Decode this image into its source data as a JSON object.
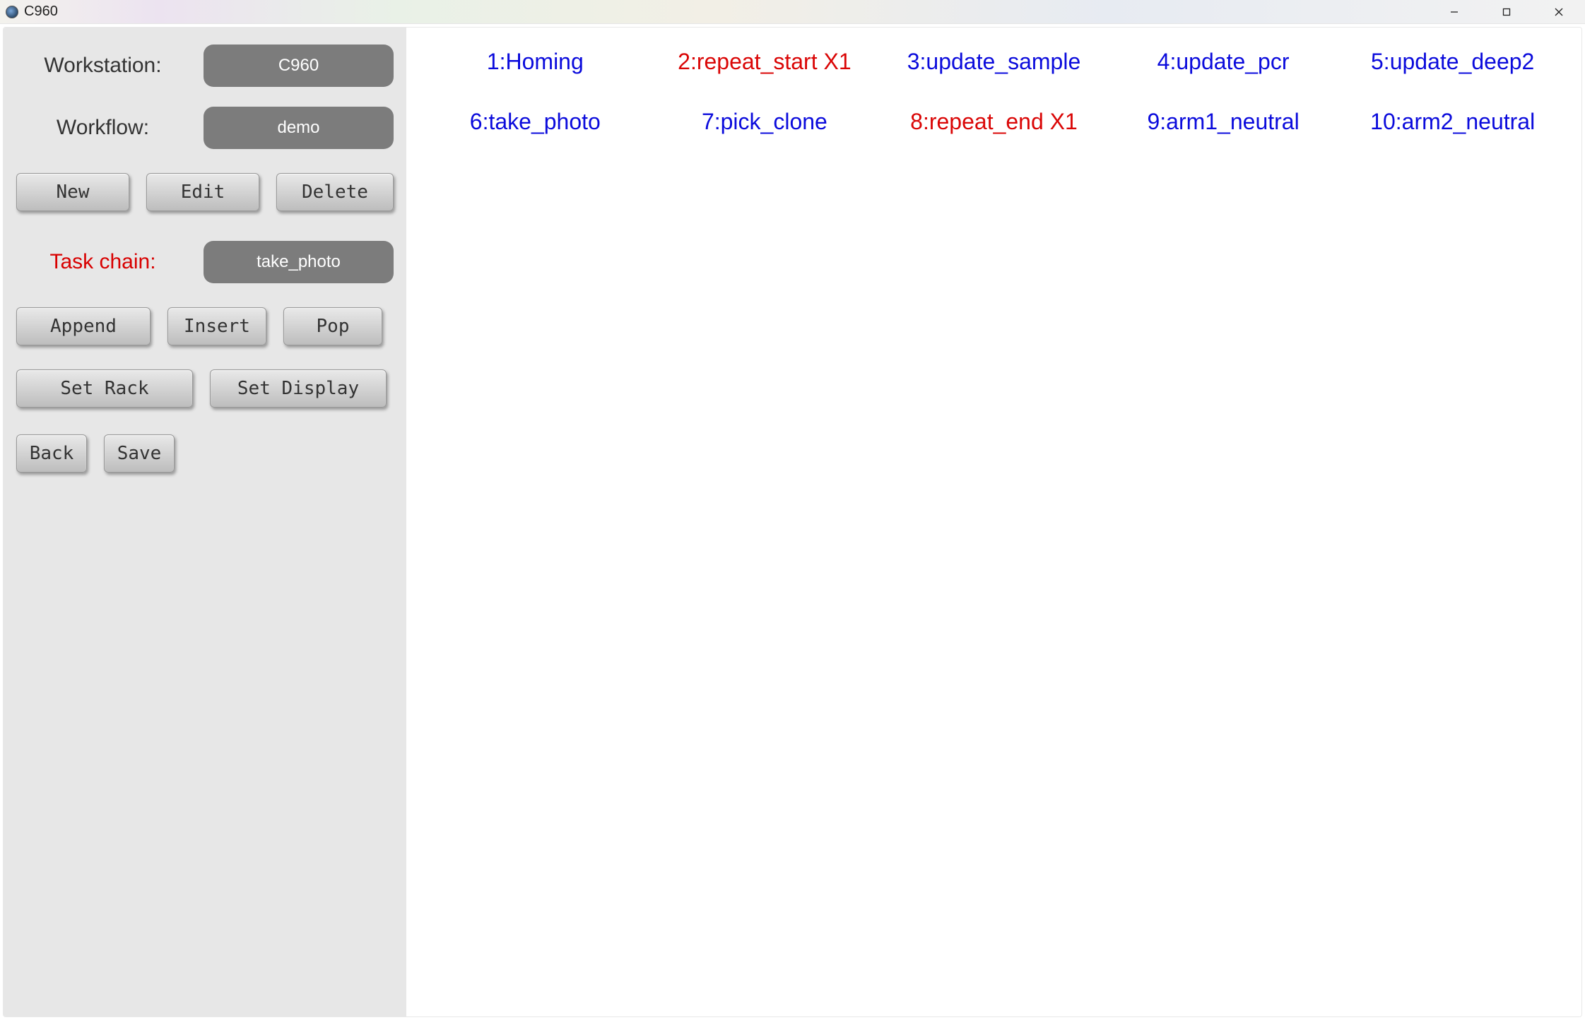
{
  "window": {
    "title": "C960"
  },
  "sidebar": {
    "workstation_label": "Workstation:",
    "workstation_value": "C960",
    "workflow_label": "Workflow:",
    "workflow_value": "demo",
    "new_btn": "New",
    "edit_btn": "Edit",
    "delete_btn": "Delete",
    "taskchain_label": "Task chain:",
    "taskchain_value": "take_photo",
    "append_btn": "Append",
    "insert_btn": "Insert",
    "pop_btn": "Pop",
    "setrack_btn": "Set Rack",
    "setdisplay_btn": "Set Display",
    "back_btn": "Back",
    "save_btn": "Save"
  },
  "tasks": [
    {
      "label": "1:Homing",
      "color": "blue"
    },
    {
      "label": "2:repeat_start X1",
      "color": "red"
    },
    {
      "label": "3:update_sample",
      "color": "blue"
    },
    {
      "label": "4:update_pcr",
      "color": "blue"
    },
    {
      "label": "5:update_deep2",
      "color": "blue"
    },
    {
      "label": "6:take_photo",
      "color": "blue"
    },
    {
      "label": "7:pick_clone",
      "color": "blue"
    },
    {
      "label": "8:repeat_end X1",
      "color": "red"
    },
    {
      "label": "9:arm1_neutral",
      "color": "blue"
    },
    {
      "label": "10:arm2_neutral",
      "color": "blue"
    }
  ]
}
